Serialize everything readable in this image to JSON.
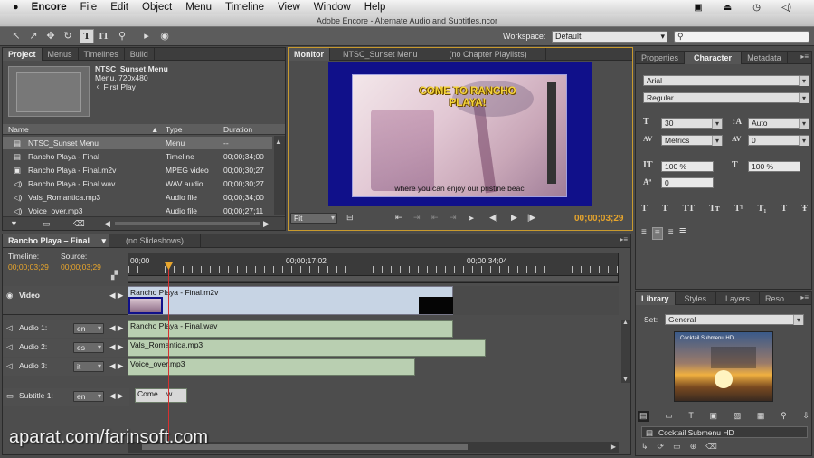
{
  "menubar": {
    "app": "Encore",
    "items": [
      "File",
      "Edit",
      "Object",
      "Menu",
      "Timeline",
      "View",
      "Window",
      "Help"
    ]
  },
  "title_bar": {
    "title": "Adobe Encore - Alternate Audio and Subtitles.ncor"
  },
  "toolbar": {
    "workspace_label": "Workspace:",
    "workspace_value": "Default",
    "search_placeholder": ""
  },
  "project_panel": {
    "tabs": [
      "Project",
      "Menus",
      "Timelines",
      "Build"
    ],
    "preview": {
      "name": "NTSC_Sunset Menu",
      "line2": "Menu, 720x480",
      "line3": "First Play"
    },
    "columns": [
      "Name",
      "Type",
      "Duration"
    ],
    "rows": [
      {
        "name": "NTSC_Sunset Menu",
        "type": "Menu",
        "duration": "--"
      },
      {
        "name": "Rancho Playa - Final",
        "type": "Timeline",
        "duration": "00;00;34;00"
      },
      {
        "name": "Rancho Playa - Final.m2v",
        "type": "MPEG video",
        "duration": "00;00;30;27"
      },
      {
        "name": "Rancho Playa - Final.wav",
        "type": "WAV audio",
        "duration": "00;00;30;27"
      },
      {
        "name": "Vals_Romantica.mp3",
        "type": "Audio file",
        "duration": "00;00;34;00"
      },
      {
        "name": "Voice_over.mp3",
        "type": "Audio file",
        "duration": "00;00;27;11"
      }
    ]
  },
  "monitor_panel": {
    "tabs": [
      "Monitor",
      "NTSC_Sunset Menu",
      "(no Chapter Playlists)"
    ],
    "video_title": "COME TO RANCHO PLAYA!",
    "subtitle": "where you can enjoy our pristine beac",
    "fit_label": "Fit",
    "timecode": "00;00;03;29"
  },
  "character_panel": {
    "tabs": [
      "Properties",
      "Character",
      "Metadata"
    ],
    "font_family": "Arial",
    "font_style": "Regular",
    "font_size": "30",
    "leading": "Auto",
    "kerning": "Metrics",
    "tracking": "0",
    "vertical_scale": "100 %",
    "horizontal_scale": "100 %",
    "baseline_shift": "0"
  },
  "library_panel": {
    "tabs": [
      "Library",
      "Styles",
      "Layers",
      "Reso"
    ],
    "set_label": "Set:",
    "set_value": "General",
    "thumbnail_title": "Cocktail Submenu HD",
    "item_name": "Cocktail Submenu HD"
  },
  "timeline_panel": {
    "tab": "Rancho Playa – Final",
    "slideshows_tab": "(no Slideshows)",
    "timeline_label": "Timeline:",
    "source_label": "Source:",
    "timeline_tc": "00;00;03;29",
    "source_tc": "00;00;03;29",
    "ruler": [
      "00;00",
      "00;00;17;02",
      "00;00;34;04"
    ],
    "tracks": [
      {
        "label": "Video",
        "lang": "",
        "clip": "Rancho Playa - Final.m2v"
      },
      {
        "label": "Audio 1:",
        "lang": "en",
        "clip": "Rancho Playa - Final.wav"
      },
      {
        "label": "Audio 2:",
        "lang": "es",
        "clip": "Vals_Romantica.mp3"
      },
      {
        "label": "Audio 3:",
        "lang": "it",
        "clip": "Voice_over.mp3"
      },
      {
        "label": "Subtitle 1:",
        "lang": "en",
        "clip": "Come... w..."
      }
    ]
  },
  "watermark": "aparat.com/farinsoft.com",
  "colors": {
    "accent_orange": "#e7a52c",
    "video_bg": "#10108a",
    "audio_clip": "#b9cfb1",
    "video_clip": "#c7d4e4",
    "playhead": "#d83030"
  }
}
